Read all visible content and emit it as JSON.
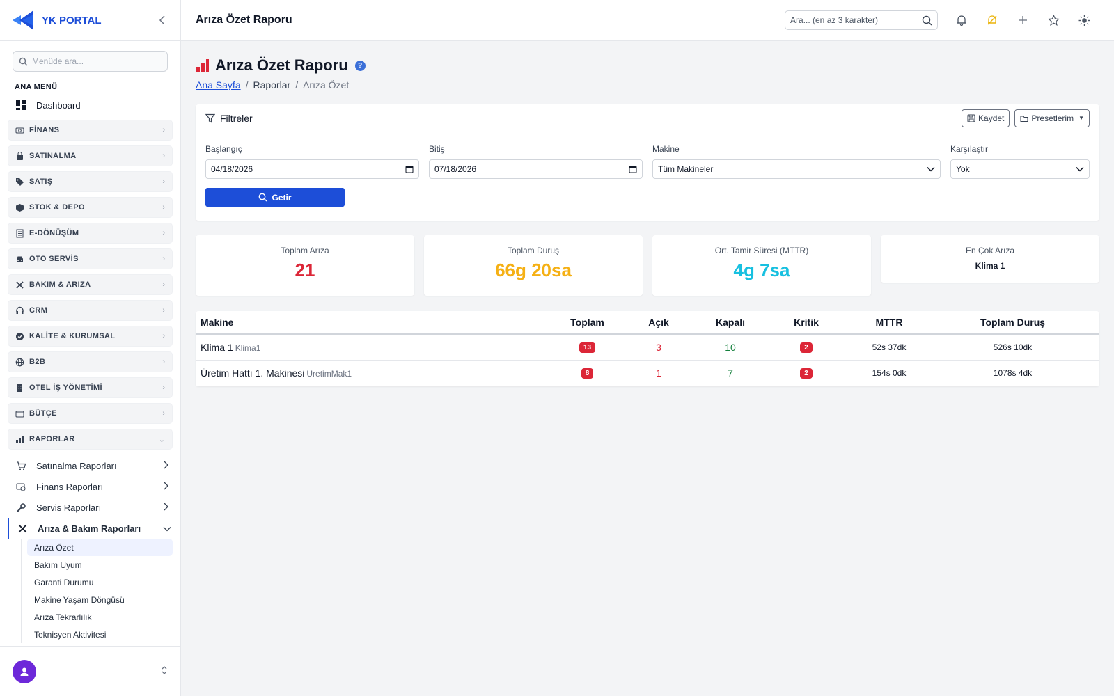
{
  "brand": {
    "name": "YK PORTAL"
  },
  "sidebar": {
    "search_placeholder": "Menüde ara...",
    "section_label": "ANA MENÜ",
    "dashboard_label": "Dashboard",
    "groups": [
      {
        "label": "FİNANS",
        "icon": "money-icon"
      },
      {
        "label": "SATINALMA",
        "icon": "bag-icon"
      },
      {
        "label": "SATIŞ",
        "icon": "tag-icon"
      },
      {
        "label": "STOK & DEPO",
        "icon": "box-icon"
      },
      {
        "label": "E-DÖNÜŞÜM",
        "icon": "receipt-icon"
      },
      {
        "label": "OTO SERVİS",
        "icon": "car-icon"
      },
      {
        "label": "BAKIM & ARIZA",
        "icon": "tools-icon"
      },
      {
        "label": "CRM",
        "icon": "headset-icon"
      },
      {
        "label": "KALİTE & KURUMSAL",
        "icon": "check-badge-icon"
      },
      {
        "label": "B2B",
        "icon": "globe-icon"
      },
      {
        "label": "OTEL İŞ YÖNETİMİ",
        "icon": "building-icon"
      },
      {
        "label": "BÜTÇE",
        "icon": "wallet-icon"
      },
      {
        "label": "RAPORLAR",
        "icon": "bar-chart-icon"
      }
    ],
    "report_subs": [
      {
        "label": "Satınalma Raporları",
        "icon": "cart-icon"
      },
      {
        "label": "Finans Raporları",
        "icon": "money-icon"
      },
      {
        "label": "Servis Raporları",
        "icon": "wrench-icon"
      },
      {
        "label": "Arıza & Bakım Raporları",
        "icon": "tools-icon"
      }
    ],
    "leaves": [
      "Arıza Özet",
      "Bakım Uyum",
      "Garanti Durumu",
      "Makine Yaşam Döngüsü",
      "Arıza Tekrarlılık",
      "Teknisyen Aktivitesi"
    ]
  },
  "topbar": {
    "title": "Arıza Özet Raporu",
    "search_placeholder": "Ara... (en az 3 karakter)"
  },
  "page": {
    "title": "Arıza Özet Raporu",
    "help": "?",
    "breadcrumb": {
      "home": "Ana Sayfa",
      "sep": "/",
      "section": "Raporlar",
      "current": "Arıza Özet"
    }
  },
  "filters": {
    "title": "Filtreler",
    "save_label": "Kaydet",
    "presets_label": "Presetlerim",
    "start": {
      "label": "Başlangıç",
      "value": "04/18/2026"
    },
    "end": {
      "label": "Bitiş",
      "value": "07/18/2026"
    },
    "machine": {
      "label": "Makine",
      "value": "Tüm Makineler"
    },
    "compare": {
      "label": "Karşılaştır",
      "value": "Yok"
    },
    "submit_label": "Getir"
  },
  "kpis": [
    {
      "label": "Toplam Arıza",
      "value": "21",
      "color": "#dc2637"
    },
    {
      "label": "Toplam Duruş",
      "value": "66g 20sa",
      "color": "#f5b014"
    },
    {
      "label": "Ort. Tamir Süresi (MTTR)",
      "value": "4g 7sa",
      "color": "#17c0e0"
    },
    {
      "label": "En Çok Arıza",
      "value": "Klima 1",
      "color": "#111827"
    }
  ],
  "table": {
    "headers": [
      "Makine",
      "Toplam",
      "Açık",
      "Kapalı",
      "Kritik",
      "MTTR",
      "Toplam Duruş"
    ],
    "rows": [
      {
        "name": "Klima 1",
        "code": "Klima1",
        "total": "13",
        "open": "3",
        "closed": "10",
        "critical": "2",
        "mttr": "52s 37dk",
        "downtime": "526s 10dk"
      },
      {
        "name": "Üretim Hattı 1. Makinesi",
        "code": "UretimMak1",
        "total": "8",
        "open": "1",
        "closed": "7",
        "critical": "2",
        "mttr": "154s 0dk",
        "downtime": "1078s 4dk"
      }
    ]
  },
  "colors": {
    "accent": "#1d4ed8",
    "danger": "#dc2637",
    "warning": "#f5b014",
    "info": "#17c0e0",
    "success": "#15803d",
    "avatar": "#6d28d9"
  }
}
